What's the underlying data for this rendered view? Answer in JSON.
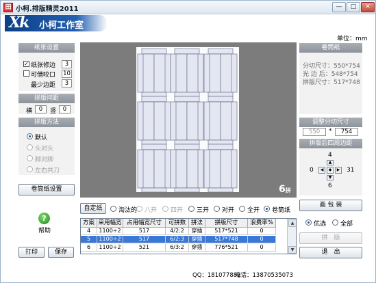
{
  "titlebar": {
    "icon_glyph": "田",
    "title": "小柯.排版精灵2011",
    "min": "—",
    "max": "□",
    "close": "✕"
  },
  "brand": {
    "mark": "Xk",
    "name": "小柯工作室"
  },
  "unit_label": "单位：mm",
  "paper_settings": {
    "header": "纸张设置",
    "trim": {
      "label": "纸张修边",
      "checked": true,
      "value": "3"
    },
    "bite": {
      "label": "可借咬口",
      "checked": false,
      "value": "10"
    },
    "min_margin": {
      "label": "最少边距",
      "value": "3"
    }
  },
  "spacing": {
    "header": "拼版间距",
    "h_label": "横",
    "h_value": "0",
    "v_label": "竖",
    "v_value": "0"
  },
  "method": {
    "header": "拼版方法",
    "options": [
      {
        "label": "默认",
        "selected": true,
        "enabled": true
      },
      {
        "label": "头对头",
        "selected": false,
        "enabled": false
      },
      {
        "label": "脚对脚",
        "selected": false,
        "enabled": false
      },
      {
        "label": "左右共刀",
        "selected": false,
        "enabled": false
      }
    ]
  },
  "roll_settings_button": "卷筒纸设置",
  "help_label": "帮助",
  "print_button": "打印",
  "save_button": "保存",
  "preview": {
    "count": "6",
    "count_unit": "拼"
  },
  "options_bar": {
    "custom_button": "自定纸",
    "radios": [
      {
        "label": "淘汰的",
        "selected": false,
        "enabled": true
      },
      {
        "label": "八开",
        "selected": false,
        "enabled": false
      },
      {
        "label": "四开",
        "selected": false,
        "enabled": false
      },
      {
        "label": "三开",
        "selected": false,
        "enabled": true
      },
      {
        "label": "对开",
        "selected": false,
        "enabled": true
      },
      {
        "label": "全开",
        "selected": false,
        "enabled": true
      },
      {
        "label": "卷筒纸",
        "selected": true,
        "enabled": true
      }
    ]
  },
  "table": {
    "columns": [
      "方案",
      "采用幅宽",
      "占用幅宽尺寸",
      "可拼数",
      "拼法",
      "拼版尺寸",
      "浪费率%"
    ],
    "rows": [
      [
        "4",
        "1100÷2",
        "517",
        "4/2:2",
        "穿插",
        "517*521",
        "0"
      ],
      [
        "5",
        "1100÷2",
        "517",
        "6/2:3",
        "穿插",
        "517*748",
        "0"
      ],
      [
        "6",
        "1100÷2",
        "521",
        "6/3:2",
        "穿插",
        "776*521",
        "0"
      ]
    ],
    "selected_index": 1
  },
  "roll": {
    "header": "卷筒纸",
    "lines": [
      "分切尺寸：550*754",
      "光 边 后：548*754",
      "拼版尺寸：517*748"
    ]
  },
  "adjust": {
    "header": "调整分切尺寸",
    "w": "550",
    "sep": "*",
    "h": "754"
  },
  "margins": {
    "header": "拼版后四周边距",
    "top": "4",
    "left": "0",
    "right": "31",
    "bottom": "6"
  },
  "right_buttons": {
    "draw": "画 包 装",
    "opt_label": "优选",
    "all_label": "全部",
    "impose": "拼　版",
    "exit": "退　出"
  },
  "status": {
    "qq": "QQ：181077882",
    "phone": "电话：13870535073"
  }
}
